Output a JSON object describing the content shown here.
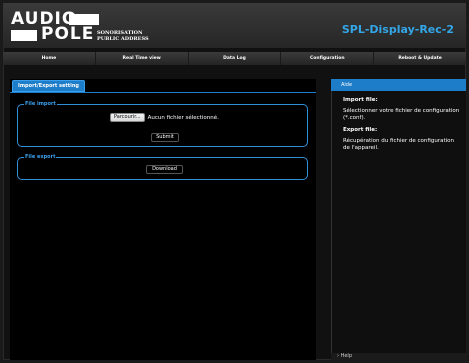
{
  "brand": {
    "logo_line1": "AUDIO",
    "logo_line2": "POLE",
    "logo_sub1": "SONORISATION",
    "logo_sub2": "PUBLIC ADDRESS",
    "site_title": "SPL-Display-Rec-2",
    "accent_color": "#33a6e8"
  },
  "nav": {
    "items": [
      "Home",
      "Real Time view",
      "Data Log",
      "Configuration",
      "Reboot & Update"
    ]
  },
  "main": {
    "tab_label": "Import/Export setting",
    "import": {
      "legend": "File import",
      "browse_label": "Parcourir...",
      "file_status": "Aucun fichier sélectionné.",
      "submit_label": "Submit"
    },
    "export": {
      "legend": "File export",
      "download_label": "Download"
    }
  },
  "aide": {
    "title": "Aide",
    "import_heading": "Import file:",
    "import_text": "Sélectionner votre fichier de configuration (*.conf).",
    "export_heading": "Export file:",
    "export_text": "Récupération du fichier de configuration de l'appareil.",
    "help_label": "Help"
  }
}
